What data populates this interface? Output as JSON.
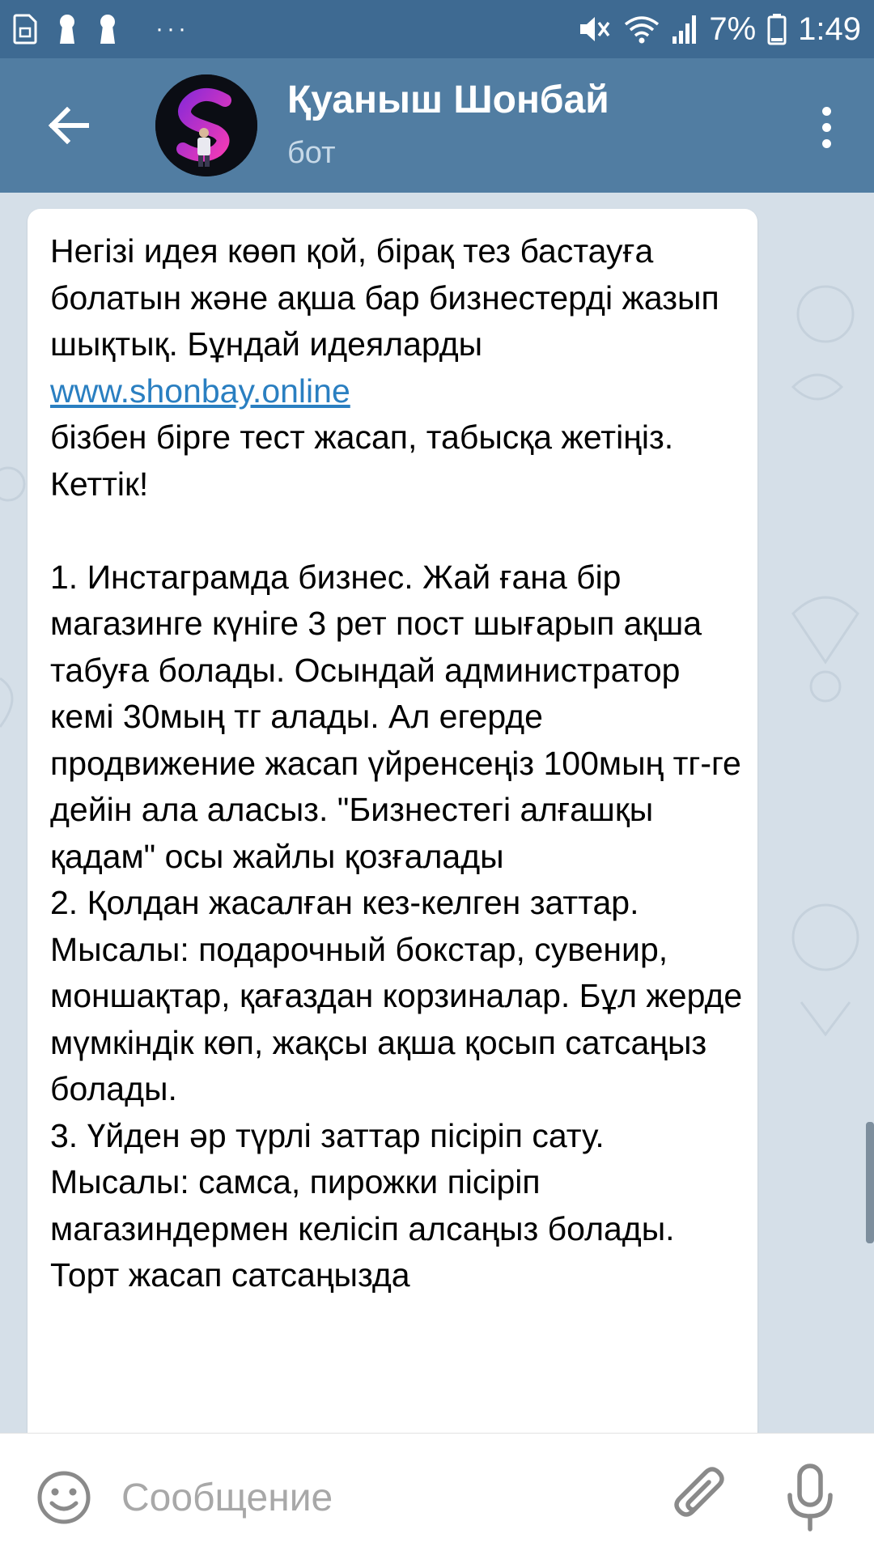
{
  "status_bar": {
    "battery_percent": "7%",
    "time": "1:49",
    "notification_dots": "···"
  },
  "header": {
    "title": "Қуаныш Шонбай",
    "subtitle": "бот"
  },
  "message": {
    "intro_before_link": "Негізі идея көөп қой, бірақ тез бастауға болатын және ақша бар бизнестерді жазып шықтық. Бұндай идеяларды ",
    "link_text": "www.shonbay.online",
    "intro_after_link": "\nбізбен бірге тест жасап, табысқа жетіңіз. Кеттік!\n\n1. Инстаграмда бизнес. Жай ғана бір магазинге күніге 3 рет пост шығарып ақша табуға болады. Осындай администратор кемі 30мың тг алады. Ал егерде продвижение жасап үйренсеңіз 100мың тг-ге дейін ала аласыз. \"Бизнестегі алғашқы қадам\" осы жайлы қозғалады\n2. Қолдан жасалған кез-келген заттар. Мысалы: подарочный бокстар, сувенир, моншақтар, қағаздан корзиналар. Бұл жерде мүмкіндік көп, жақсы ақша қосып сатсаңыз болады.\n3. Үйден әр түрлі заттар пісіріп сату. Мысалы: самса, пирожки пісіріп магазиндермен келісіп алсаңыз болады. Торт жасап сатсаңызда"
  },
  "input": {
    "placeholder": "Сообщение",
    "value": ""
  },
  "colors": {
    "status_bar": "#3e6a92",
    "header": "#517da2",
    "chat_bg": "#d5dfe8",
    "link": "#2a7fc1"
  },
  "icons": {
    "back": "arrow-left-icon",
    "more": "more-vertical-icon",
    "emoji": "smiley-icon",
    "attach": "paperclip-icon",
    "mic": "microphone-icon"
  }
}
